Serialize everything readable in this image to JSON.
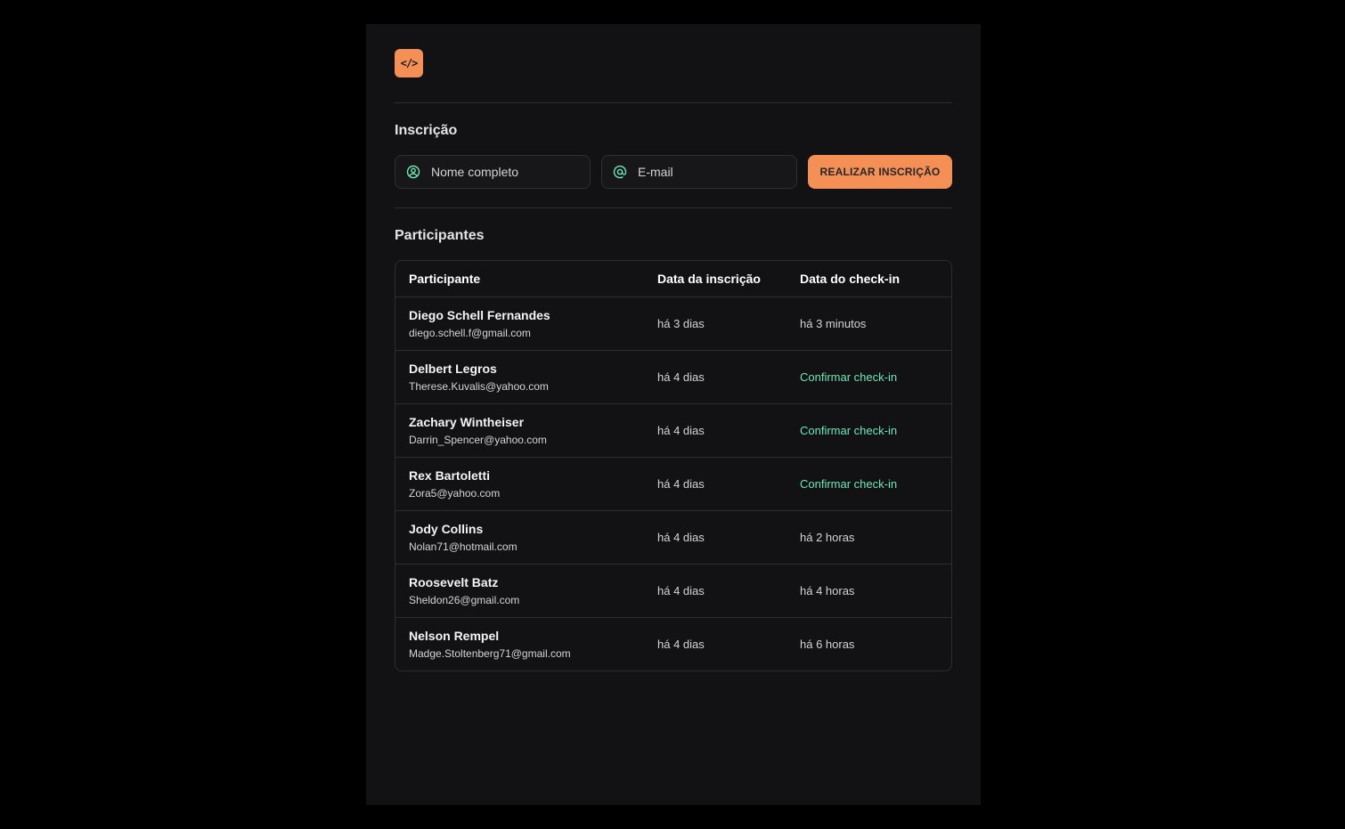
{
  "header": {
    "logo_text": "</>"
  },
  "registration": {
    "title": "Inscrição",
    "name_placeholder": "Nome completo",
    "email_placeholder": "E-mail",
    "submit_label": "REALIZAR INSCRIÇÃO",
    "icon_color": "#6ee7b7"
  },
  "participants": {
    "title": "Participantes",
    "columns": [
      "Participante",
      "Data da inscrição",
      "Data do check-in"
    ],
    "rows": [
      {
        "name": "Diego Schell Fernandes",
        "email": "diego.schell.f@gmail.com",
        "registered": "há 3 dias",
        "checkin": "há 3 minutos"
      },
      {
        "name": "Delbert Legros",
        "email": "Therese.Kuvalis@yahoo.com",
        "registered": "há 4 dias",
        "checkin": "Confirmar check-in"
      },
      {
        "name": "Zachary Wintheiser",
        "email": "Darrin_Spencer@yahoo.com",
        "registered": "há 4 dias",
        "checkin": "Confirmar check-in"
      },
      {
        "name": "Rex Bartoletti",
        "email": "Zora5@yahoo.com",
        "registered": "há 4 dias",
        "checkin": "Confirmar check-in"
      },
      {
        "name": "Jody Collins",
        "email": "Nolan71@hotmail.com",
        "registered": "há 4 dias",
        "checkin": "há 2 horas"
      },
      {
        "name": "Roosevelt Batz",
        "email": "Sheldon26@gmail.com",
        "registered": "há 4 dias",
        "checkin": "há 4 horas"
      },
      {
        "name": "Nelson Rempel",
        "email": "Madge.Stoltenberg71@gmail.com",
        "registered": "há 4 dias",
        "checkin": "há 6 horas"
      }
    ]
  },
  "colors": {
    "accent": "#f48f56",
    "link": "#6ee7b7",
    "panel": "#121214",
    "page": "#000000"
  }
}
